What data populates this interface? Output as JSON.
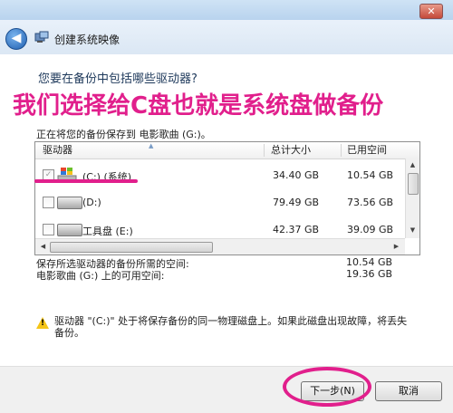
{
  "window": {
    "title": "创建系统映像",
    "close_label": "✕"
  },
  "page": {
    "question": "您要在备份中包括哪些驱动器?",
    "annotation": "我们选择给C盘也就是系统盘做备份",
    "saving_to": "正在将您的备份保存到 电影歌曲 (G:)。"
  },
  "table": {
    "columns": [
      "驱动器",
      "总计大小",
      "已用空间"
    ],
    "rows": [
      {
        "name": "(C:) (系统)",
        "total": "34.40 GB",
        "used": "10.54 GB",
        "checked": true,
        "disabled": true
      },
      {
        "name": "(D:)",
        "total": "79.49 GB",
        "used": "73.56 GB",
        "checked": false,
        "disabled": false
      },
      {
        "name": "工具盘 (E:)",
        "total": "42.37 GB",
        "used": "39.09 GB",
        "checked": false,
        "disabled": false
      }
    ]
  },
  "summary": {
    "required_label": "保存所选驱动器的备份所需的空间:",
    "required_value": "10.54 GB",
    "available_label": "电影歌曲 (G:) 上的可用空间:",
    "available_value": "19.36 GB"
  },
  "warning": {
    "text": "驱动器 \"(C:)\" 处于将保存备份的同一物理磁盘上。如果此磁盘出现故障，将丢失备份。"
  },
  "buttons": {
    "next": "下一步(N)",
    "cancel": "取消"
  },
  "colors": {
    "annotation": "#e11f8c",
    "title_blue": "#1e395b"
  }
}
